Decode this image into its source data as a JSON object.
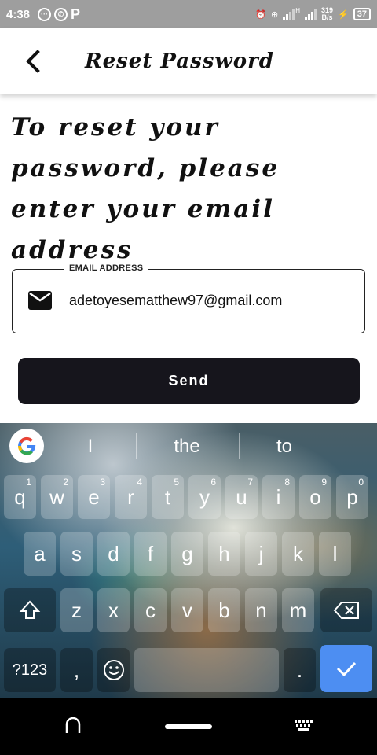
{
  "status_bar": {
    "time": "4:38",
    "network_speed_value": "319",
    "network_speed_unit": "B/s",
    "signal_label": "H",
    "battery": "37"
  },
  "app_bar": {
    "title": "Reset Password"
  },
  "main": {
    "heading": "To reset your password, please enter your email address",
    "email_field": {
      "label": "EMAIL ADDRESS",
      "value": "adetoyesematthew97@gmail.com"
    },
    "send_label": "Send"
  },
  "keyboard": {
    "suggestions": [
      "I",
      "the",
      "to"
    ],
    "row1": [
      "q",
      "w",
      "e",
      "r",
      "t",
      "y",
      "u",
      "i",
      "o",
      "p"
    ],
    "row1_hints": [
      "1",
      "2",
      "3",
      "4",
      "5",
      "6",
      "7",
      "8",
      "9",
      "0"
    ],
    "row2": [
      "a",
      "s",
      "d",
      "f",
      "g",
      "h",
      "j",
      "k",
      "l"
    ],
    "row3": [
      "z",
      "x",
      "c",
      "v",
      "b",
      "n",
      "m"
    ],
    "symbols_label": "?123",
    "comma_label": ",",
    "period_label": "."
  },
  "colors": {
    "primary_button": "#16151c",
    "enter_key": "#4d8ef2",
    "status_bar": "#9e9e9e"
  }
}
